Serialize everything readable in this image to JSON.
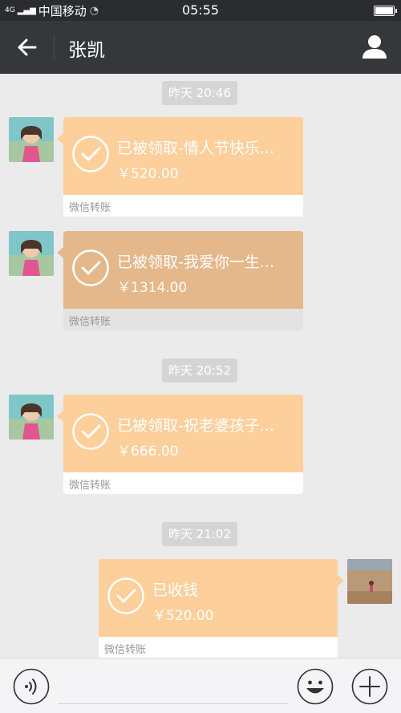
{
  "status_bar": {
    "signal": "4G",
    "carrier": "中国移动",
    "time": "05:55"
  },
  "header": {
    "back_icon": "arrow-left-icon",
    "title": "张凯",
    "profile_icon": "person-icon"
  },
  "messages": [
    {
      "timestamp": "昨天 20:46"
    },
    {
      "sender": "other",
      "status": "已被领取-情人节快乐...",
      "amount": "￥520.00",
      "footer": "微信转账"
    },
    {
      "sender": "other",
      "status": "已被领取-我爱你一生...",
      "amount": "￥1314.00",
      "footer": "微信转账"
    },
    {
      "timestamp": "昨天 20:52"
    },
    {
      "sender": "other",
      "status": "已被领取-祝老婆孩子...",
      "amount": "￥666.00",
      "footer": "微信转账"
    },
    {
      "timestamp": "昨天 21:02"
    },
    {
      "sender": "self",
      "status": "已收钱",
      "amount": "￥520.00",
      "footer": "微信转账"
    }
  ],
  "input_bar": {
    "voice_icon": "voice-icon",
    "emoji_icon": "emoji-icon",
    "plus_icon": "plus-icon"
  },
  "colors": {
    "card": "#fdcf9b",
    "card_pressed": "#e4b88a",
    "header": "#36373b",
    "status_bar": "#2b2c30",
    "background": "#ebebeb"
  }
}
